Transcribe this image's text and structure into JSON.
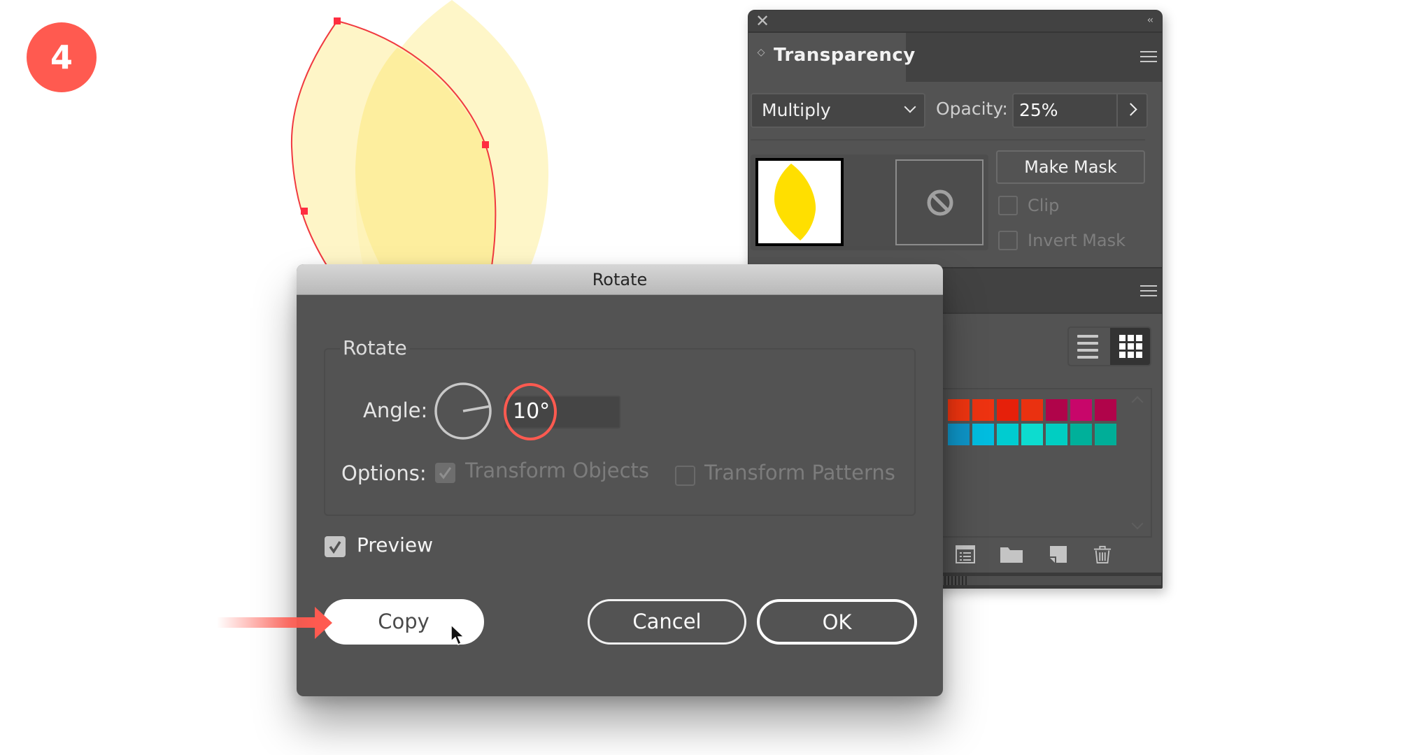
{
  "step_badge": {
    "number": "4",
    "color": "#ff5a50"
  },
  "artwork": {
    "original_leaf": {
      "fill": "#fef6c8",
      "state": "unselected"
    },
    "rotated_leaf": {
      "fill": "#fef6c8",
      "overlap_fill": "#fdee9e",
      "selection_color": "#f0393f",
      "state": "selected"
    }
  },
  "transparency_panel": {
    "tab_label": "Transparency",
    "blend_mode": {
      "selected": "Multiply"
    },
    "opacity": {
      "label": "Opacity:",
      "value": "25%"
    },
    "object_thumbnail": {
      "fill": "#ffdf00"
    },
    "make_mask_label": "Make Mask",
    "clip": {
      "label": "Clip",
      "checked": false,
      "enabled": false
    },
    "invert_mask": {
      "label": "Invert Mask",
      "checked": false,
      "enabled": false
    }
  },
  "swatches_panel": {
    "view_mode": "grid",
    "rows": [
      [
        "#f03510",
        "#ee3311",
        "#e6200a",
        "#ea3110",
        "#b0044a",
        "#c8066a",
        "#b0044a"
      ],
      [
        "#0e95c8",
        "#00bde0",
        "#00ccd0",
        "#0ddccf",
        "#00cec2",
        "#00b09a",
        "#00ae98"
      ]
    ],
    "footer_icons": [
      "swatch-libraries-icon",
      "new-color-group-icon",
      "new-swatch-icon",
      "delete-swatch-icon"
    ]
  },
  "rotate_dialog": {
    "title": "Rotate",
    "group_label": "Rotate",
    "angle_label": "Angle:",
    "angle_value": "10°",
    "angle_degrees": 10,
    "options_label": "Options:",
    "transform_objects": {
      "label": "Transform Objects",
      "checked": true,
      "enabled": false
    },
    "transform_patterns": {
      "label": "Transform Patterns",
      "checked": false,
      "enabled": false
    },
    "preview": {
      "label": "Preview",
      "checked": true
    },
    "buttons": {
      "copy": "Copy",
      "cancel": "Cancel",
      "ok": "OK"
    },
    "highlight_color": "#ff5a50"
  }
}
